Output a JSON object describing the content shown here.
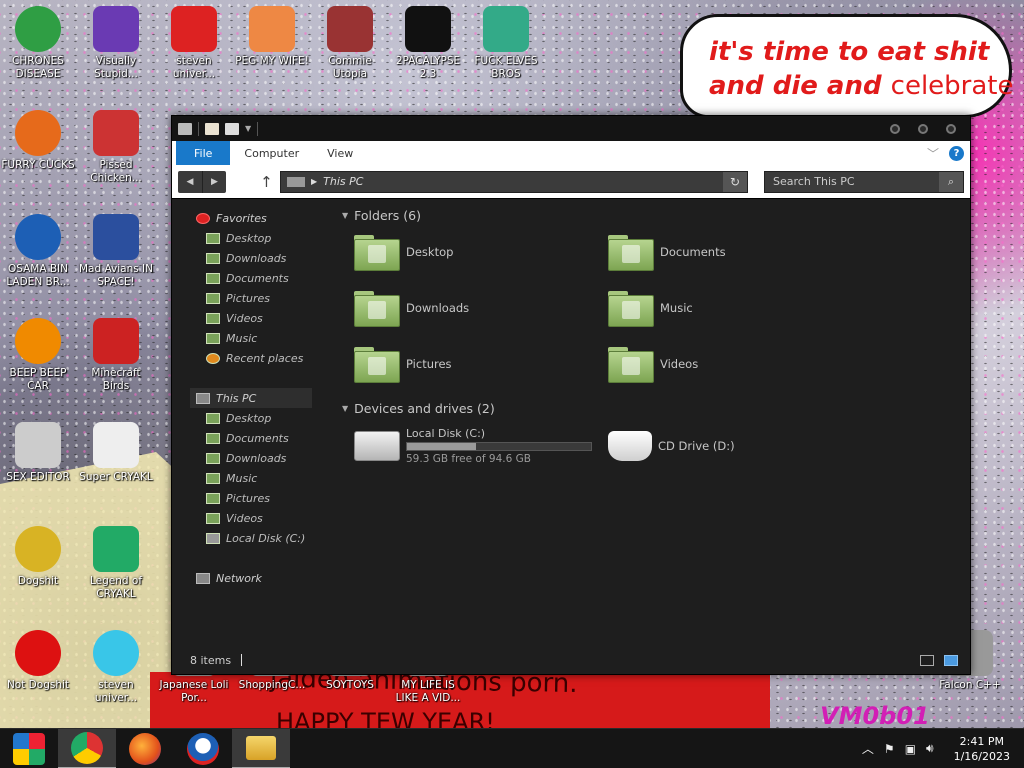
{
  "wallpaper": {
    "speech_line1": "it's time to eat shit",
    "speech_line2_bold": "and die and",
    "speech_line2_plain": "celebrate",
    "banner_line1": "jaiden animations porn.",
    "banner_line2": "HAPPY TEW YEAR!",
    "watermark": "VM0b01"
  },
  "desktop_icons": [
    {
      "label": "CHRONES DISEASE",
      "icon": "chrome-icon",
      "color": "#2f9e44"
    },
    {
      "label": "Visually Stupid...",
      "icon": "visual-studio-icon",
      "color": "#6a3ab3"
    },
    {
      "label": "steven univer...",
      "icon": "steven-universe-icon",
      "color": "#d22"
    },
    {
      "label": "PEG MY WIFE!",
      "icon": "peggle-icon",
      "color": "#e84"
    },
    {
      "label": "Commie Utopia",
      "icon": "commie-icon",
      "color": "#933"
    },
    {
      "label": "2PACALYPSE 2.3",
      "icon": "terminal-icon",
      "color": "#111"
    },
    {
      "label": "FUCK ELVES BROS",
      "icon": "elves-icon",
      "color": "#3a8"
    },
    {
      "label": "FURRY CUCKS",
      "icon": "firefox-icon",
      "color": "#e66a1b"
    },
    {
      "label": "Pissed Chicken...",
      "icon": "angry-birds-seasons-icon",
      "color": "#c33"
    },
    {
      "label": "OSAMA BIN LADEN BR...",
      "icon": "obama-icon",
      "color": "#1d5fb5"
    },
    {
      "label": "Mad Avians IN SPACE!",
      "icon": "angry-birds-space-icon",
      "color": "#2b4f9e"
    },
    {
      "label": "BEEP BEEP CAR",
      "icon": "vlc-icon",
      "color": "#f08a00"
    },
    {
      "label": "Minecraft Birds",
      "icon": "angry-birds-icon",
      "color": "#c22"
    },
    {
      "label": "SEX EDITOR",
      "icon": "hxd-icon",
      "color": "#ccc"
    },
    {
      "label": "Super CRYAKL",
      "icon": "cryakl-icon",
      "color": "#eee"
    },
    {
      "label": "Dogshit",
      "icon": "codeblocks-icon",
      "color": "#d8b324"
    },
    {
      "label": "Legend of CRYAKL",
      "icon": "legend-icon",
      "color": "#2a6"
    },
    {
      "label": "Not Dogshit",
      "icon": "devcpp-icon",
      "color": "#d11"
    },
    {
      "label": "steven univer...",
      "icon": "diamond-icon",
      "color": "#39c6e8"
    },
    {
      "label": "Japanese Loli Por...",
      "icon": "doc-icon",
      "color": "#aaa"
    },
    {
      "label": "ShoppingC...",
      "icon": "doc-icon",
      "color": "#aaa"
    },
    {
      "label": "SOYTOYS",
      "icon": "doc-icon",
      "color": "#aaa"
    },
    {
      "label": "MY LIFE IS LIKE A VID...",
      "icon": "doc-icon",
      "color": "#aaa"
    },
    {
      "label": "Falcon C++",
      "icon": "recycle-bin-icon",
      "color": "#999"
    }
  ],
  "explorer": {
    "ribbon_tabs": [
      "File",
      "Computer",
      "View"
    ],
    "address": "This PC",
    "search_placeholder": "Search This PC",
    "nav": {
      "favorites_header": "Favorites",
      "favorites": [
        "Desktop",
        "Downloads",
        "Documents",
        "Pictures",
        "Videos",
        "Music",
        "Recent places"
      ],
      "thispc_header": "This PC",
      "thispc": [
        "Desktop",
        "Documents",
        "Downloads",
        "Music",
        "Pictures",
        "Videos",
        "Local Disk (C:)"
      ],
      "network": "Network"
    },
    "folders_header": "Folders (6)",
    "folders": [
      "Desktop",
      "Documents",
      "Downloads",
      "Music",
      "Pictures",
      "Videos"
    ],
    "devices_header": "Devices and drives (2)",
    "drives": [
      {
        "name": "Local Disk (C:)",
        "free": "59.3 GB free of 94.6 GB",
        "used_fraction": 0.373
      },
      {
        "name": "CD Drive (D:)"
      }
    ],
    "status": "8 items"
  },
  "taskbar": {
    "time": "2:41 PM",
    "date": "1/16/2023"
  }
}
